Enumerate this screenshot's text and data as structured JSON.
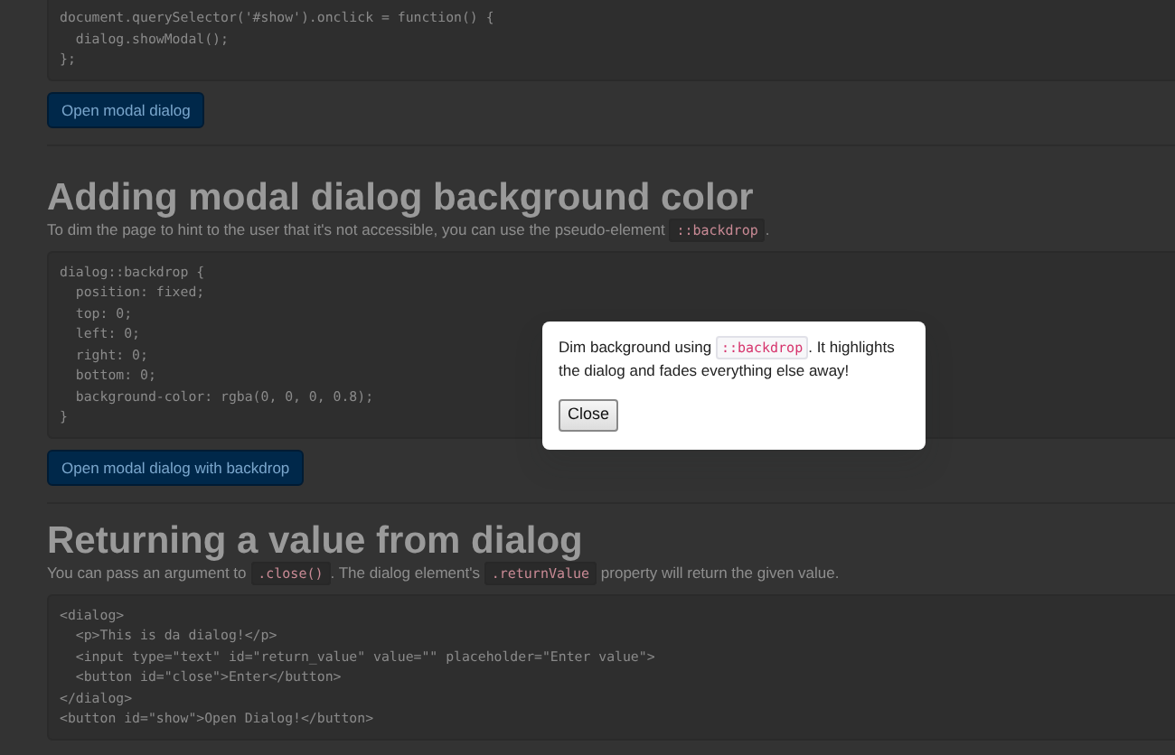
{
  "sections": [
    {
      "code": [
        "document.querySelector('#show').onclick = function() {",
        "  dialog.showModal();",
        "};"
      ],
      "button": "Open modal dialog"
    },
    {
      "heading": "Adding modal dialog background color",
      "intro": [
        {
          "kind": "text",
          "text": "To dim the page to hint to the user that it's not accessible, you can use the pseudo-element "
        },
        {
          "kind": "code",
          "text": "::backdrop"
        },
        {
          "kind": "text",
          "text": "."
        }
      ],
      "code": [
        "dialog::backdrop {",
        "  position: fixed;",
        "  top: 0;",
        "  left: 0;",
        "  right: 0;",
        "  bottom: 0;",
        "  background-color: rgba(0, 0, 0, 0.8);",
        "}"
      ],
      "button": "Open modal dialog with backdrop"
    },
    {
      "heading": "Returning a value from dialog",
      "intro": [
        {
          "kind": "text",
          "text": "You can pass an argument to "
        },
        {
          "kind": "code",
          "text": ".close()"
        },
        {
          "kind": "text",
          "text": ". The dialog element's "
        },
        {
          "kind": "code",
          "text": ".returnValue"
        },
        {
          "kind": "text",
          "text": " property will return the given value."
        }
      ],
      "code": [
        "<dialog>",
        "  <p>This is da dialog!</p>",
        "  <input type=\"text\" id=\"return_value\" value=\"\" placeholder=\"Enter value\">",
        "  <button id=\"close\">Enter</button>",
        "</dialog>",
        "<button id=\"show\">Open Dialog!</button>"
      ]
    }
  ],
  "dialog": {
    "text": [
      {
        "kind": "text",
        "text": "Dim background using "
      },
      {
        "kind": "code",
        "text": "::backdrop"
      },
      {
        "kind": "text",
        "text": ". It highlights the dialog and fades everything else away!"
      }
    ],
    "button": "Close"
  }
}
